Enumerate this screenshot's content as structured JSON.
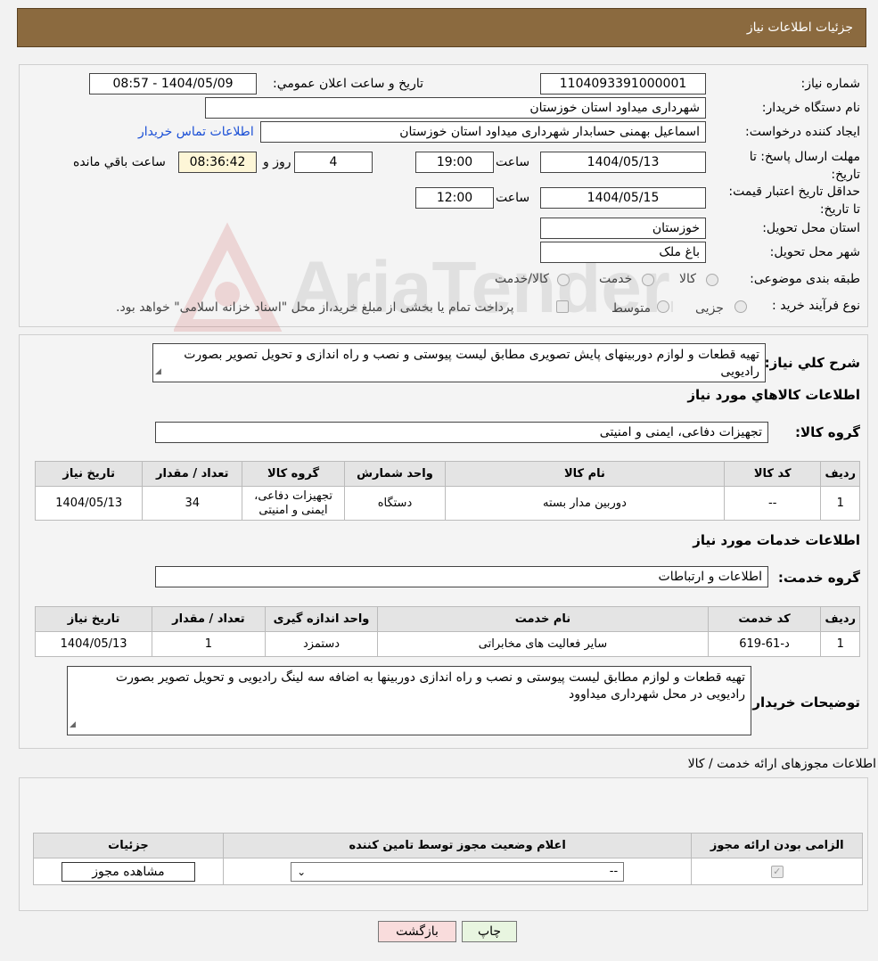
{
  "header": {
    "title": "جزئیات اطلاعات نیاز"
  },
  "watermark": {
    "text": "AriaTender.neT"
  },
  "need": {
    "number_label": "شماره نیاز:",
    "number": "1104093391000001",
    "announce_label": "تاریخ و ساعت اعلان عمومي:",
    "announce_value": "1404/05/09 - 08:57",
    "buyer_org_label": "نام دستگاه خریدار:",
    "buyer_org": "شهرداری میداود استان خوزستان",
    "creator_label": "ایجاد کننده درخواست:",
    "creator": "اسماعیل بهمنی حسابدار شهرداری میداود استان خوزستان",
    "contact_link": "اطلاعات تماس خریدار",
    "deadline_label": "مهلت ارسال پاسخ: تا تاریخ:",
    "deadline_date": "1404/05/13",
    "time_label": "ساعت",
    "deadline_time": "19:00",
    "days": "4",
    "days_label": "روز و",
    "remaining": "08:36:42",
    "remaining_label": "ساعت باقي مانده",
    "validity_label": "حداقل تاریخ اعتبار قیمت: تا تاریخ:",
    "validity_date": "1404/05/15",
    "validity_time": "12:00",
    "province_label": "استان محل تحویل:",
    "province": "خوزستان",
    "city_label": "شهر محل تحویل:",
    "city": "باغ ملک",
    "category_label": "طبقه بندی موضوعی:",
    "category_options": [
      "کالا",
      "خدمت",
      "کالا/خدمت"
    ],
    "process_label": "نوع فرآیند خرید :",
    "process_options": [
      "جزیی",
      "متوسط"
    ],
    "process_note": "پرداخت تمام یا بخشی از مبلغ خرید،از محل \"اسناد خزانه اسلامی\" خواهد بود."
  },
  "description": {
    "label": "شرح کلي نیاز:",
    "text": "تهیه قطعات و لوازم دوربینهای پایش تصویری مطابق لیست پیوستی و نصب و راه اندازی و تحویل تصویر بصورت رادیویی"
  },
  "goods": {
    "section_title": "اطلاعات کالاهاي مورد نیاز",
    "group_label": "گروه کالا:",
    "group": "تجهیزات دفاعی، ایمنی و امنیتی",
    "headers": [
      "ردیف",
      "کد کالا",
      "نام کالا",
      "واحد شمارش",
      "گروه کالا",
      "تعداد / مقدار",
      "تاریخ نیاز"
    ],
    "rows": [
      [
        "1",
        "--",
        "دوربین مدار بسته",
        "دستگاه",
        "تجهیزات دفاعی، ایمنی و امنیتی",
        "34",
        "1404/05/13"
      ]
    ]
  },
  "services": {
    "section_title": "اطلاعات خدمات مورد نیاز",
    "group_label": "گروه خدمت:",
    "group": "اطلاعات و ارتباطات",
    "headers": [
      "ردیف",
      "کد خدمت",
      "نام خدمت",
      "واحد اندازه گیری",
      "تعداد / مقدار",
      "تاریخ نیاز"
    ],
    "rows": [
      [
        "1",
        "د-61-619",
        "سایر فعالیت های مخابراتی",
        "دستمزد",
        "1",
        "1404/05/13"
      ]
    ]
  },
  "buyer_notes": {
    "label": "توضیحات خریدار:",
    "text": "تهیه قطعات و لوازم مطابق لیست پیوستی و نصب و راه اندازی دوربینها به اضافه سه لینگ رادیویی و تحویل تصویر بصورت رادیویی در محل شهرداری میداوود"
  },
  "permits": {
    "section_title": "اطلاعات مجوزهای ارائه خدمت / کالا",
    "headers": [
      "الزامی بودن ارائه مجوز",
      "اعلام وضعیت مجوز توسط تامین کننده",
      "جزئیات"
    ],
    "select_value": "--",
    "view_button": "مشاهده مجوز"
  },
  "footer": {
    "print_button": "چاپ",
    "back_button": "بازگشت"
  }
}
